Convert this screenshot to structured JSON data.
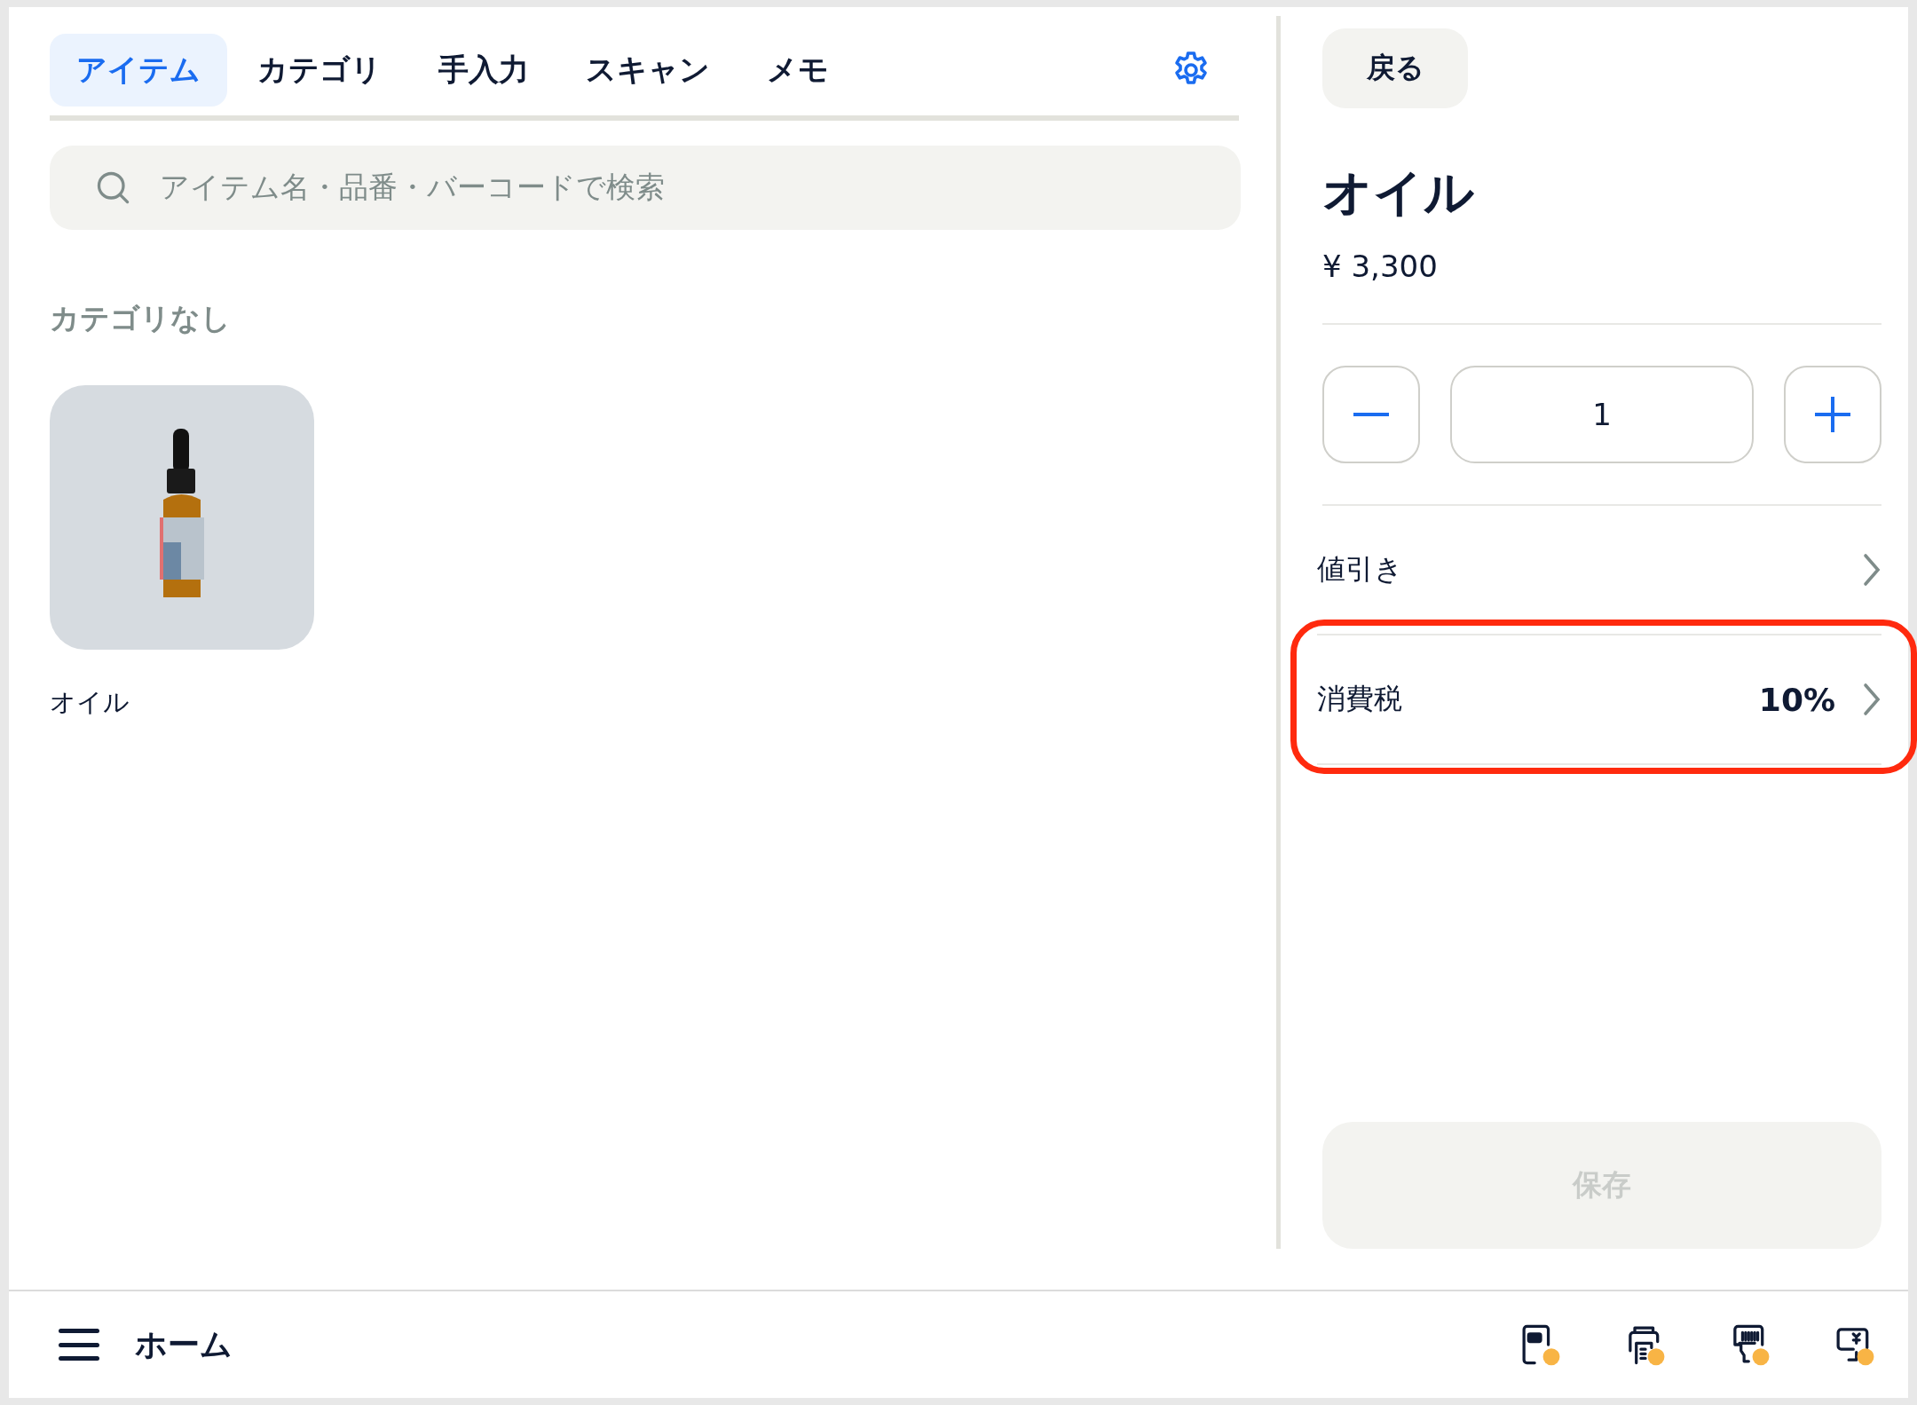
{
  "tabs": [
    {
      "label": "アイテム",
      "selected": true
    },
    {
      "label": "カテゴリ",
      "selected": false
    },
    {
      "label": "手入力",
      "selected": false
    },
    {
      "label": "スキャン",
      "selected": false
    },
    {
      "label": "メモ",
      "selected": false
    }
  ],
  "search": {
    "placeholder": "アイテム名・品番・バーコードで検索"
  },
  "category": {
    "title": "カテゴリなし",
    "items": [
      {
        "name": "オイル"
      }
    ]
  },
  "detail": {
    "back_button": "戻る",
    "title": "オイル",
    "price": "¥ 3,300",
    "quantity": "1",
    "rows": [
      {
        "label": "値引き",
        "highlighted": false
      },
      {
        "label": "消費税",
        "value": "10%",
        "highlighted": true
      }
    ],
    "save_button": {
      "label": "保存",
      "disabled": true
    }
  },
  "bottom_bar": {
    "title": "ホーム",
    "devices": [
      {
        "kind": "reader",
        "alert": true
      },
      {
        "kind": "printer",
        "alert": true
      },
      {
        "kind": "scanner",
        "alert": true
      },
      {
        "kind": "display",
        "alert": true
      }
    ]
  }
}
